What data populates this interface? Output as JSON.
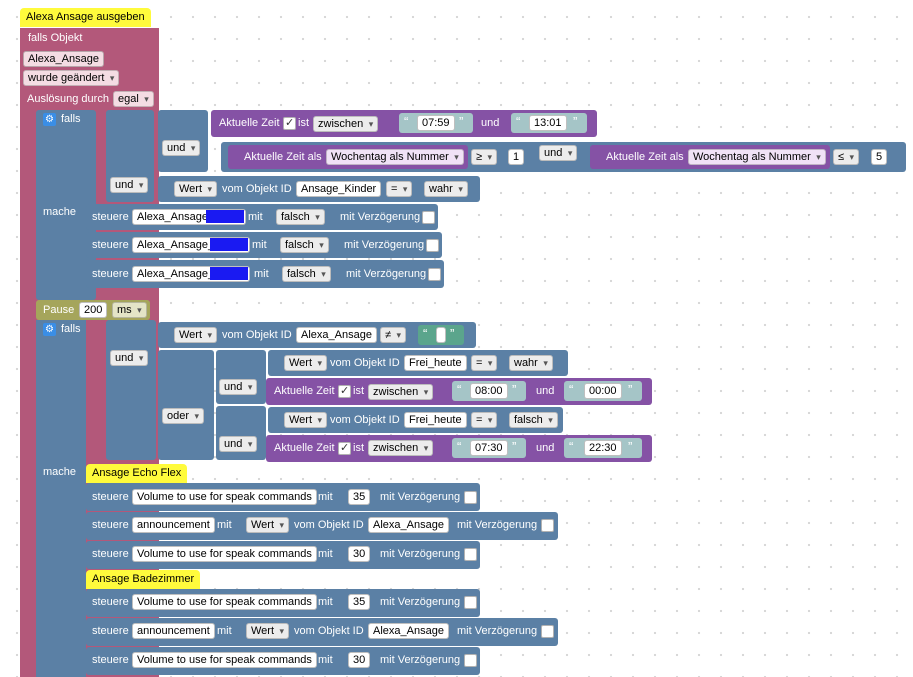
{
  "comment_title": "Alexa Ansage ausgeben",
  "trigger": {
    "label_falls_objekt": "falls Objekt",
    "object_id": "Alexa_Ansage",
    "changed": "wurde geändert",
    "trigger_by": "Auslösung durch",
    "trigger_value": "egal"
  },
  "if1": {
    "falls": "falls",
    "und": "und",
    "time1": {
      "label": "Aktuelle Zeit",
      "ist": "ist",
      "mode": "zwischen",
      "from": "07:59",
      "und": "und",
      "to": "13:01"
    },
    "weekday_a": {
      "label": "Aktuelle Zeit als",
      "mode": "Wochentag als Nummer",
      "op": "≥",
      "value": "1"
    },
    "weekday_b": {
      "label": "Aktuelle Zeit als",
      "mode": "Wochentag als Nummer",
      "op": "≤",
      "value": "5"
    },
    "state": {
      "what": "Wert",
      "of": "vom Objekt ID",
      "id": "Ansage_Kinder",
      "op": "=",
      "value": "wahr"
    },
    "mache": "mache",
    "controls": [
      {
        "steuere": "steuere",
        "target": "Alexa_Ansage",
        "mit": "mit",
        "value": "falsch",
        "delay": "mit Verzögerung"
      },
      {
        "steuere": "steuere",
        "target": "Alexa_Ansage_",
        "mit": "mit",
        "value": "falsch",
        "delay": "mit Verzögerung"
      },
      {
        "steuere": "steuere",
        "target": "Alexa_Ansage_",
        "mit": "mit",
        "value": "falsch",
        "delay": "mit Verzögerung"
      }
    ]
  },
  "pause": {
    "label": "Pause",
    "value": "200",
    "unit": "ms"
  },
  "if2": {
    "falls": "falls",
    "und": "und",
    "oder": "oder",
    "neq": {
      "what": "Wert",
      "of": "vom Objekt ID",
      "id": "Alexa_Ansage",
      "op": "≠"
    },
    "frei1": {
      "what": "Wert",
      "of": "vom Objekt ID",
      "id": "Frei_heute",
      "op": "=",
      "value": "wahr"
    },
    "time2": {
      "label": "Aktuelle Zeit",
      "ist": "ist",
      "mode": "zwischen",
      "from": "08:00",
      "und": "und",
      "to": "00:00"
    },
    "frei2": {
      "what": "Wert",
      "of": "vom Objekt ID",
      "id": "Frei_heute",
      "op": "=",
      "value": "falsch"
    },
    "time3": {
      "label": "Aktuelle Zeit",
      "ist": "ist",
      "mode": "zwischen",
      "from": "07:30",
      "und": "und",
      "to": "22:30"
    },
    "mache": "mache"
  },
  "section_flex": "Ansage Echo Flex",
  "section_bad": "Ansage Badezimmer",
  "flex": [
    {
      "steuere": "steuere",
      "target": "Volume to use for speak commands",
      "mit": "mit",
      "value": "35",
      "delay": "mit Verzögerung"
    },
    {
      "steuere": "steuere",
      "target": "announcement",
      "mit": "mit",
      "what": "Wert",
      "of": "vom Objekt ID",
      "id": "Alexa_Ansage",
      "delay": "mit Verzögerung"
    },
    {
      "steuere": "steuere",
      "target": "Volume to use for speak commands",
      "mit": "mit",
      "value": "30",
      "delay": "mit Verzögerung"
    }
  ],
  "bad": [
    {
      "steuere": "steuere",
      "target": "Volume to use for speak commands",
      "mit": "mit",
      "value": "35",
      "delay": "mit Verzögerung"
    },
    {
      "steuere": "steuere",
      "target": "announcement",
      "mit": "mit",
      "what": "Wert",
      "of": "vom Objekt ID",
      "id": "Alexa_Ansage",
      "delay": "mit Verzögerung"
    },
    {
      "steuere": "steuere",
      "target": "Volume to use for speak commands",
      "mit": "mit",
      "value": "30",
      "delay": "mit Verzögerung"
    }
  ],
  "colors": {
    "event": "#b3587a",
    "logic": "#5b80a5",
    "time": "#8552a5",
    "pause": "#a5a55b",
    "comment": "#fffb3c",
    "redaction": "#1a1af2"
  }
}
